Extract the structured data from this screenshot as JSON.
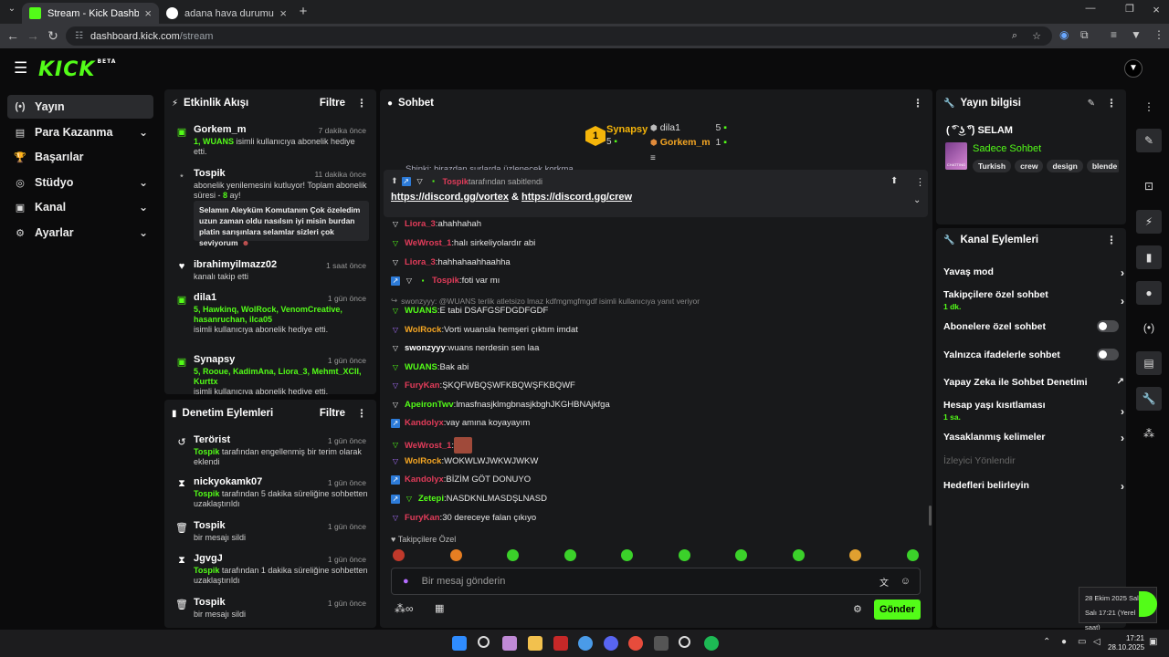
{
  "browser": {
    "tabs": [
      {
        "title": "Stream - Kick Dashboard",
        "active": true,
        "favicon_color": "#53fc18"
      },
      {
        "title": "adana hava durumu - Google'da",
        "active": false,
        "favicon_color": "#ffffff"
      }
    ],
    "url_host": "dashboard.kick.com",
    "url_path": "/stream"
  },
  "app": {
    "logo": "KICK",
    "logo_badge": "BETA",
    "brand_color": "#53fc18"
  },
  "nav": {
    "items": [
      {
        "label": "Yayın",
        "icon": "broadcast-icon",
        "glyph": "(•)",
        "active": true,
        "chevron": false
      },
      {
        "label": "Para Kazanma",
        "icon": "money-icon",
        "glyph": "▤",
        "active": false,
        "chevron": true
      },
      {
        "label": "Başarılar",
        "icon": "trophy-icon",
        "glyph": "🏆",
        "active": false,
        "chevron": false
      },
      {
        "label": "Stüdyo",
        "icon": "studio-icon",
        "glyph": "◎",
        "active": false,
        "chevron": true
      },
      {
        "label": "Kanal",
        "icon": "channel-icon",
        "glyph": "▣",
        "active": false,
        "chevron": true
      },
      {
        "label": "Ayarlar",
        "icon": "settings-icon",
        "glyph": "⚙",
        "active": false,
        "chevron": true
      }
    ]
  },
  "activity": {
    "title": "Etkinlik Akışı",
    "filter": "Filtre",
    "events": [
      {
        "name": "Gorkem_m",
        "time": "7 dakika önce",
        "g": "1, WUANS",
        "text": " isimli kullanıcıya abonelik hediye etti."
      },
      {
        "name": "Tospik",
        "time": "11 dakika önce",
        "pre": "abonelik yenilemesini kutluyor! Toplam abonelik süresi - ",
        "g": "8",
        "text": " ay!",
        "quote": "Selamın Aleyküm Komutanım Çok özeledim uzun zaman oldu nasılsın iyi misin burdan platin sarışınlara selamlar sizleri çok seviyorum"
      },
      {
        "name": "ibrahimyilmazz02",
        "time": "1 saat önce",
        "text": "kanalı takip etti"
      },
      {
        "name": "dila1",
        "time": "1 gün önce",
        "g": "5, Hawkinq, WolRock, VenomCreative, hasanruchan, ilca05",
        "text": "isimli kullanıcıya abonelik hediye etti."
      },
      {
        "name": "Synapsy",
        "time": "1 gün önce",
        "g": "5, Rooue, KadimAna, Liora_3, Mehmt_XCII, Kurttx",
        "text": "isimli kullanıcıya abonelik hediye etti."
      }
    ]
  },
  "moderation": {
    "title": "Denetim Eylemleri",
    "filter": "Filtre",
    "events": [
      {
        "name": "Terörist",
        "time": "1 gün önce",
        "g": "Tospik",
        "text": " tarafından engellenmiş bir terim olarak eklendi"
      },
      {
        "name": "nickyokamk07",
        "time": "1 gün önce",
        "g": "Tospik",
        "text": " tarafından 5 dakika süreliğine sohbetten uzaklaştırıldı"
      },
      {
        "name": "Tospik",
        "time": "1 gün önce",
        "text": "bir mesajı sildi"
      },
      {
        "name": "JgvgJ",
        "time": "1 gün önce",
        "g": "Tospik",
        "text": " tarafından 1 dakika süreliğine sohbetten uzaklaştırıldı"
      },
      {
        "name": "Tospik",
        "time": "1 gün önce",
        "text": "bir mesajı sildi"
      }
    ]
  },
  "chat": {
    "title": "Sohbet",
    "leaderboard": {
      "first_rank": "1",
      "first_name": "Synapsy",
      "first_count": "5",
      "others": [
        {
          "rank": "2",
          "name": "dila1",
          "count": "5"
        },
        {
          "rank": "3",
          "name": "Gorkem_m",
          "count": "1"
        }
      ]
    },
    "scrolled_line": "Shinki: birazdan surlarda üzlenecek korkma",
    "pinned": {
      "by": "Tospik",
      "by_suffix": " tarafından sabitlendi",
      "link1": "https://discord.gg/vortex",
      "sep": " & ",
      "link2": "https://discord.gg/crew"
    },
    "messages": [
      {
        "user": "Liora_3",
        "color": "#e23c5a",
        "badges": [
          "vw"
        ],
        "text": "ahahhahah"
      },
      {
        "user": "WeWrost_1",
        "color": "#e23c5a",
        "badges": [
          "v"
        ],
        "text": "halı sirkeliyolardır abi"
      },
      {
        "user": "Liora_3",
        "color": "#e23c5a",
        "badges": [
          "vw"
        ],
        "text": "hahhahaahhaahha"
      },
      {
        "user": "Tospik",
        "color": "#e23c5a",
        "badges": [
          "mod",
          "vw",
          "sub"
        ],
        "text": "foti var mı"
      },
      {
        "reply": "swonzyyy: @WUANS terlik atletsizo lmaz kdfmgmgfmgdf isimli kullanıcıya yanıt veriyor"
      },
      {
        "user": "WUANS",
        "color": "#53fc18",
        "badges": [
          "v"
        ],
        "text": "E tabi DSAFGSFDGDFGDF"
      },
      {
        "user": "WolRock",
        "color": "#f5a623",
        "badges": [
          "vp"
        ],
        "text": "Vorti wuansla hemşeri çıktım imdat"
      },
      {
        "user": "swonzyyy",
        "color": "#ffffff",
        "badges": [
          "vw"
        ],
        "text": "wuans nerdesin sen laa"
      },
      {
        "user": "WUANS",
        "color": "#53fc18",
        "badges": [
          "v"
        ],
        "text": "Bak abi"
      },
      {
        "user": "FuryKan",
        "color": "#e23c5a",
        "badges": [
          "vp"
        ],
        "text": "ŞKQFWBQŞWFKBQWŞFKBQWF"
      },
      {
        "user": "ApeironTwv",
        "color": "#53fc18",
        "badges": [
          "vw"
        ],
        "text": "lmasfnasjklmgbnasjkbghJKGHBNAjkfga"
      },
      {
        "user": "Kandolyx",
        "color": "#e23c5a",
        "badges": [
          "mod"
        ],
        "text": "vay amına koyayayım"
      },
      {
        "user": "WeWrost_1",
        "color": "#e23c5a",
        "badges": [
          "v"
        ],
        "text": "",
        "emote": true
      },
      {
        "user": "WolRock",
        "color": "#f5a623",
        "badges": [
          "vp"
        ],
        "text": "WOKWLWJWKWJWKW"
      },
      {
        "user": "Kandolyx",
        "color": "#e23c5a",
        "badges": [
          "mod"
        ],
        "text": "BİZİM GÖT DONUYO"
      },
      {
        "user": "Zetepi",
        "color": "#53fc18",
        "badges": [
          "mod",
          "v"
        ],
        "text": "NASDKNLMASDŞLNASD"
      },
      {
        "user": "FuryKan",
        "color": "#e23c5a",
        "badges": [
          "vp"
        ],
        "text": "30 dereceye falan çıkıyo"
      }
    ],
    "emote_section": "Takipçilere Özel",
    "input_placeholder": "Bir mesaj gönderin",
    "send_label": "Gönder"
  },
  "stream_info": {
    "title": "Yayın bilgisi",
    "stream_title": "( ͡° ͜ʖ ͡°) SELAM",
    "category": "Sadece Sohbet",
    "thumb_label": "CHATTING",
    "tags": [
      "Turkish",
      "crew",
      "design",
      "blende"
    ]
  },
  "channel_actions": {
    "title": "Kanal Eylemleri",
    "items": [
      {
        "label": "Yavaş mod",
        "type": "chevron"
      },
      {
        "label": "Takipçilere özel sohbet",
        "sub": "1 dk.",
        "type": "chevron"
      },
      {
        "label": "Abonelere özel sohbet",
        "type": "toggle"
      },
      {
        "label": "Yalnızca ifadelerle sohbet",
        "type": "toggle"
      },
      {
        "label": "Yapay Zeka ile Sohbet Denetimi",
        "type": "external"
      },
      {
        "label": "Hesap yaşı kısıtlaması",
        "sub": "1 sa.",
        "type": "chevron"
      },
      {
        "label": "Yasaklanmış kelimeler",
        "type": "chevron"
      },
      {
        "label": "İzleyici Yönlendir",
        "type": "disabled"
      },
      {
        "label": "Hedefleri belirleyin",
        "type": "chevron"
      }
    ]
  },
  "taskbar": {
    "popup_date": "28 Ekim 2025 Salı",
    "popup_time": "Salı 17:21 (Yerel saat)",
    "time": "17:21",
    "date": "28.10.2025"
  }
}
